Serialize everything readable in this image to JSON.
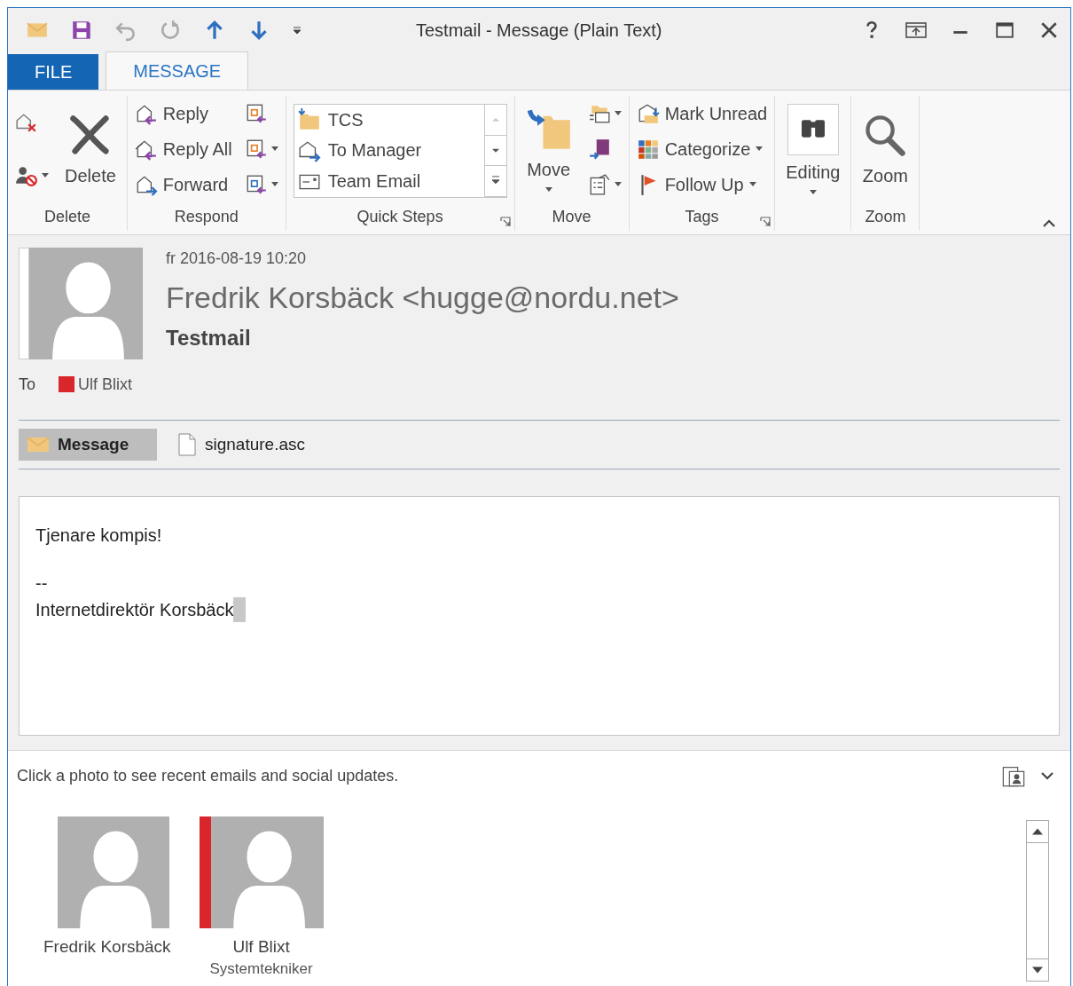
{
  "window": {
    "title": "Testmail - Message (Plain Text)"
  },
  "tabs": [
    {
      "label": "FILE",
      "kind": "file",
      "selected": false
    },
    {
      "label": "MESSAGE",
      "kind": "tab",
      "selected": true
    }
  ],
  "ribbon": {
    "groups": [
      {
        "label": "Delete",
        "columns": [
          [
            {
              "kind": "icon"
            },
            {
              "kind": "icon",
              "dropdown": true
            }
          ],
          [
            {
              "kind": "large",
              "label": "Delete"
            }
          ]
        ]
      },
      {
        "label": "Respond",
        "columns": [
          [
            {
              "kind": "small",
              "label": "Reply"
            },
            {
              "kind": "small",
              "label": "Reply All"
            },
            {
              "kind": "small",
              "label": "Forward"
            }
          ],
          [
            {
              "kind": "icon"
            },
            {
              "kind": "icon",
              "dropdown": true
            },
            {
              "kind": "icon",
              "dropdown": true
            }
          ]
        ]
      },
      {
        "label": "Quick Steps",
        "launcher": true,
        "columns": [
          [
            {
              "kind": "gallery",
              "steps": [
                "TCS",
                "To Manager",
                "Team Email"
              ]
            }
          ]
        ]
      },
      {
        "label": "Move",
        "columns": [
          [
            {
              "kind": "large",
              "label": "Move",
              "dropdown": true
            }
          ],
          [
            {
              "kind": "icon",
              "dropdown": true
            },
            {
              "kind": "icon"
            },
            {
              "kind": "icon",
              "dropdown": true
            }
          ]
        ]
      },
      {
        "label": "Tags",
        "launcher": true,
        "columns": [
          [
            {
              "kind": "small",
              "label": "Mark Unread"
            },
            {
              "kind": "small",
              "label": "Categorize",
              "dropdown": true
            },
            {
              "kind": "small",
              "label": "Follow Up",
              "dropdown": true
            }
          ]
        ]
      },
      {
        "columns": [
          [
            {
              "kind": "boxed",
              "label": "Editing",
              "dropdown": true
            }
          ]
        ]
      },
      {
        "label": "Zoom",
        "columns": [
          [
            {
              "kind": "large",
              "label": "Zoom"
            }
          ]
        ]
      }
    ]
  },
  "message": {
    "date": "fr 2016-08-19 10:20",
    "sender": "Fredrik Korsbäck <hugge@nordu.net>",
    "subject": "Testmail",
    "to_label": "To",
    "recipients": [
      {
        "name": "Ulf Blixt",
        "color": "#d9262b"
      }
    ],
    "attachments": [
      {
        "label": "Message",
        "kind": "message",
        "selected": true
      },
      {
        "label": "signature.asc",
        "kind": "file",
        "selected": false
      }
    ],
    "body": [
      [
        "Tjenare kompis!"
      ],
      [
        "--",
        "Internetdirektör Korsbäck"
      ]
    ]
  },
  "people_pane": {
    "hint": "Click a photo to see recent emails and social updates.",
    "contacts": [
      {
        "name": "Fredrik Korsbäck",
        "color": "#ffffff"
      },
      {
        "name": "Ulf Blixt",
        "title": "Systemtekniker",
        "color": "#d9262b"
      }
    ]
  }
}
